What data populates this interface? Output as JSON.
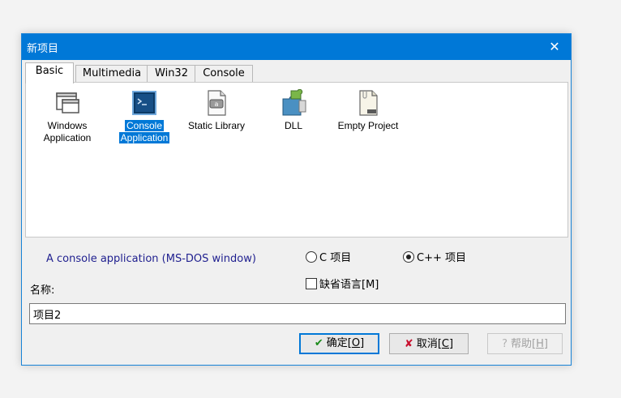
{
  "window": {
    "title": "新项目",
    "close_glyph": "✕"
  },
  "tabs": [
    {
      "label": "Basic",
      "active": true
    },
    {
      "label": "Multimedia",
      "active": false
    },
    {
      "label": "Win32",
      "active": false
    },
    {
      "label": "Console",
      "active": false
    }
  ],
  "templates": [
    {
      "line1": "Windows",
      "line2": "Application",
      "icon": "windows-application-icon",
      "selected": false
    },
    {
      "line1": "Console",
      "line2": "Application",
      "icon": "console-application-icon",
      "selected": true
    },
    {
      "line1": "Static Library",
      "line2": "",
      "icon": "static-library-icon",
      "selected": false
    },
    {
      "line1": "DLL",
      "line2": "",
      "icon": "dll-icon",
      "selected": false
    },
    {
      "line1": "Empty Project",
      "line2": "",
      "icon": "empty-project-icon",
      "selected": false
    }
  ],
  "description": "A console application (MS-DOS window)",
  "language": {
    "c_label": "C 项目",
    "cpp_label": "C++ 项目",
    "selected": "C++"
  },
  "default_language": {
    "label": "缺省语言[M]",
    "checked": false
  },
  "name": {
    "label": "名称:",
    "value": "项目2"
  },
  "buttons": {
    "ok_text": "确定[",
    "ok_key": "O",
    "ok_end": "]",
    "cancel_text": "取消[",
    "cancel_key": "C",
    "cancel_end": "]",
    "help_text": "帮助[",
    "help_key": "H",
    "help_end": "]",
    "help_enabled": false
  },
  "colors": {
    "accent": "#0078d7",
    "description_text": "#1f1f8f"
  }
}
